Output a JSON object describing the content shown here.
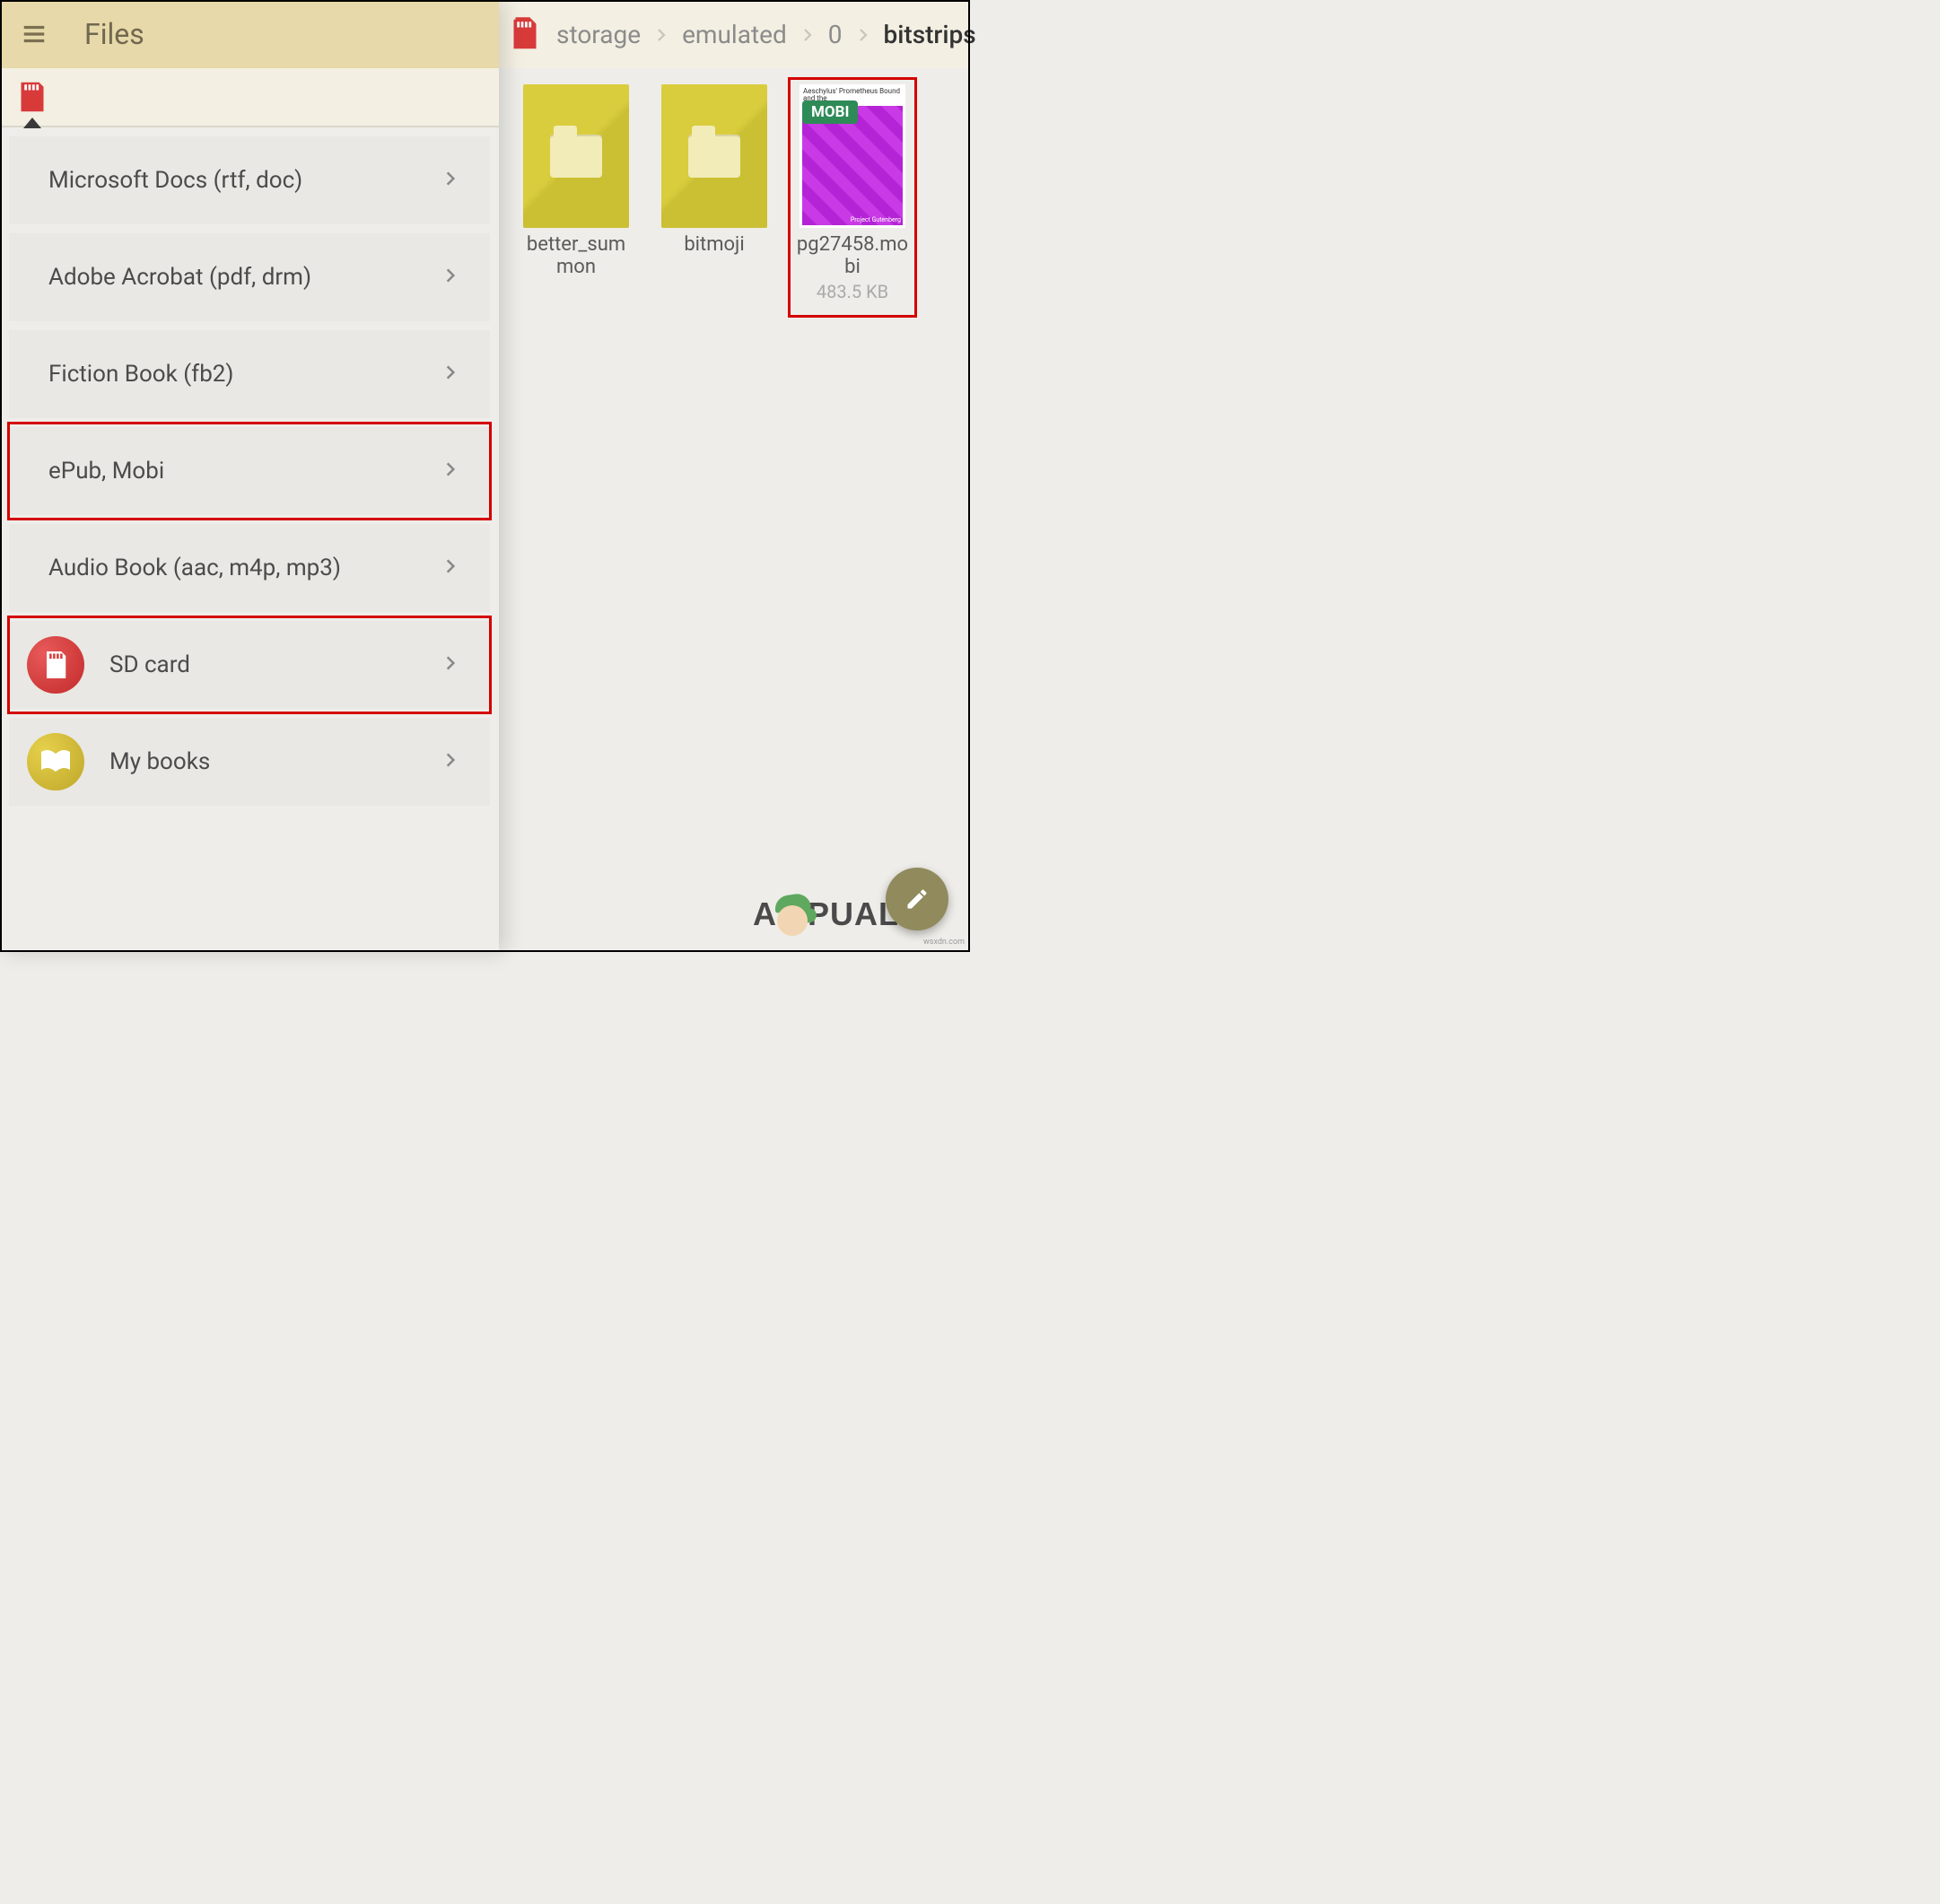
{
  "drawer": {
    "title": "Files",
    "tab_icon": "sdcard-icon",
    "items": [
      {
        "label": "Microsoft Docs (rtf, doc)",
        "icon": null,
        "highlighted": false
      },
      {
        "label": "Adobe Acrobat (pdf, drm)",
        "icon": null,
        "highlighted": false
      },
      {
        "label": "Fiction Book (fb2)",
        "icon": null,
        "highlighted": false
      },
      {
        "label": "ePub, Mobi",
        "icon": null,
        "highlighted": true
      },
      {
        "label": "Audio Book (aac, m4p, mp3)",
        "icon": null,
        "highlighted": false
      },
      {
        "label": "SD card",
        "icon": "sdcard",
        "highlighted": true
      },
      {
        "label": "My books",
        "icon": "book",
        "highlighted": false
      }
    ]
  },
  "breadcrumbs": {
    "parts": [
      "storage",
      "emulated",
      "0",
      "bitstrips"
    ],
    "active_index": 3
  },
  "files": [
    {
      "type": "folder",
      "name": "better_summon"
    },
    {
      "type": "folder",
      "name": "bitmoji"
    },
    {
      "type": "mobi",
      "name": "pg27458.mobi",
      "size": "483.5 KB",
      "badge": "MOBI",
      "highlighted": true
    }
  ],
  "watermark": "A  PUALS",
  "credit": "wsxdn.com"
}
